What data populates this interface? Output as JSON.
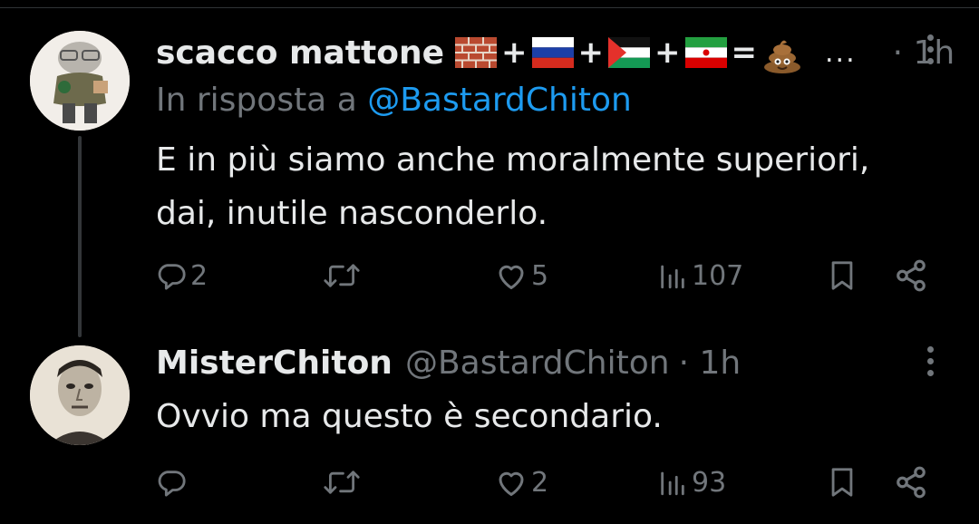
{
  "tweets": [
    {
      "name": "scacco mattone",
      "flags": [
        "brick-emoji",
        "plus",
        "russia-flag",
        "plus",
        "palestine-flag",
        "plus",
        "iran-flag",
        "equals",
        "poop-emoji"
      ],
      "ellipsis": "...",
      "time": "· 1h",
      "reply_prefix": "In risposta a ",
      "reply_handle": "@BastardChiton",
      "text_line1": "E in più siamo anche moralmente superiori,",
      "text_line2": "dai, inutile nasconderlo.",
      "replies": "2",
      "retweets": "",
      "likes": "5",
      "views": "107"
    },
    {
      "name": "MisterChiton",
      "handle": "@BastardChiton",
      "time": "· 1h",
      "text_line1": "Ovvio ma questo è secondario.",
      "replies": "",
      "retweets": "",
      "likes": "2",
      "views": "93"
    }
  ],
  "symbols": {
    "plus": "+",
    "equals": "="
  },
  "colors": {
    "background": "#000000",
    "text": "#e7e9ea",
    "secondary": "#71767b",
    "link": "#1d9bf0",
    "thread_line": "#333639"
  }
}
